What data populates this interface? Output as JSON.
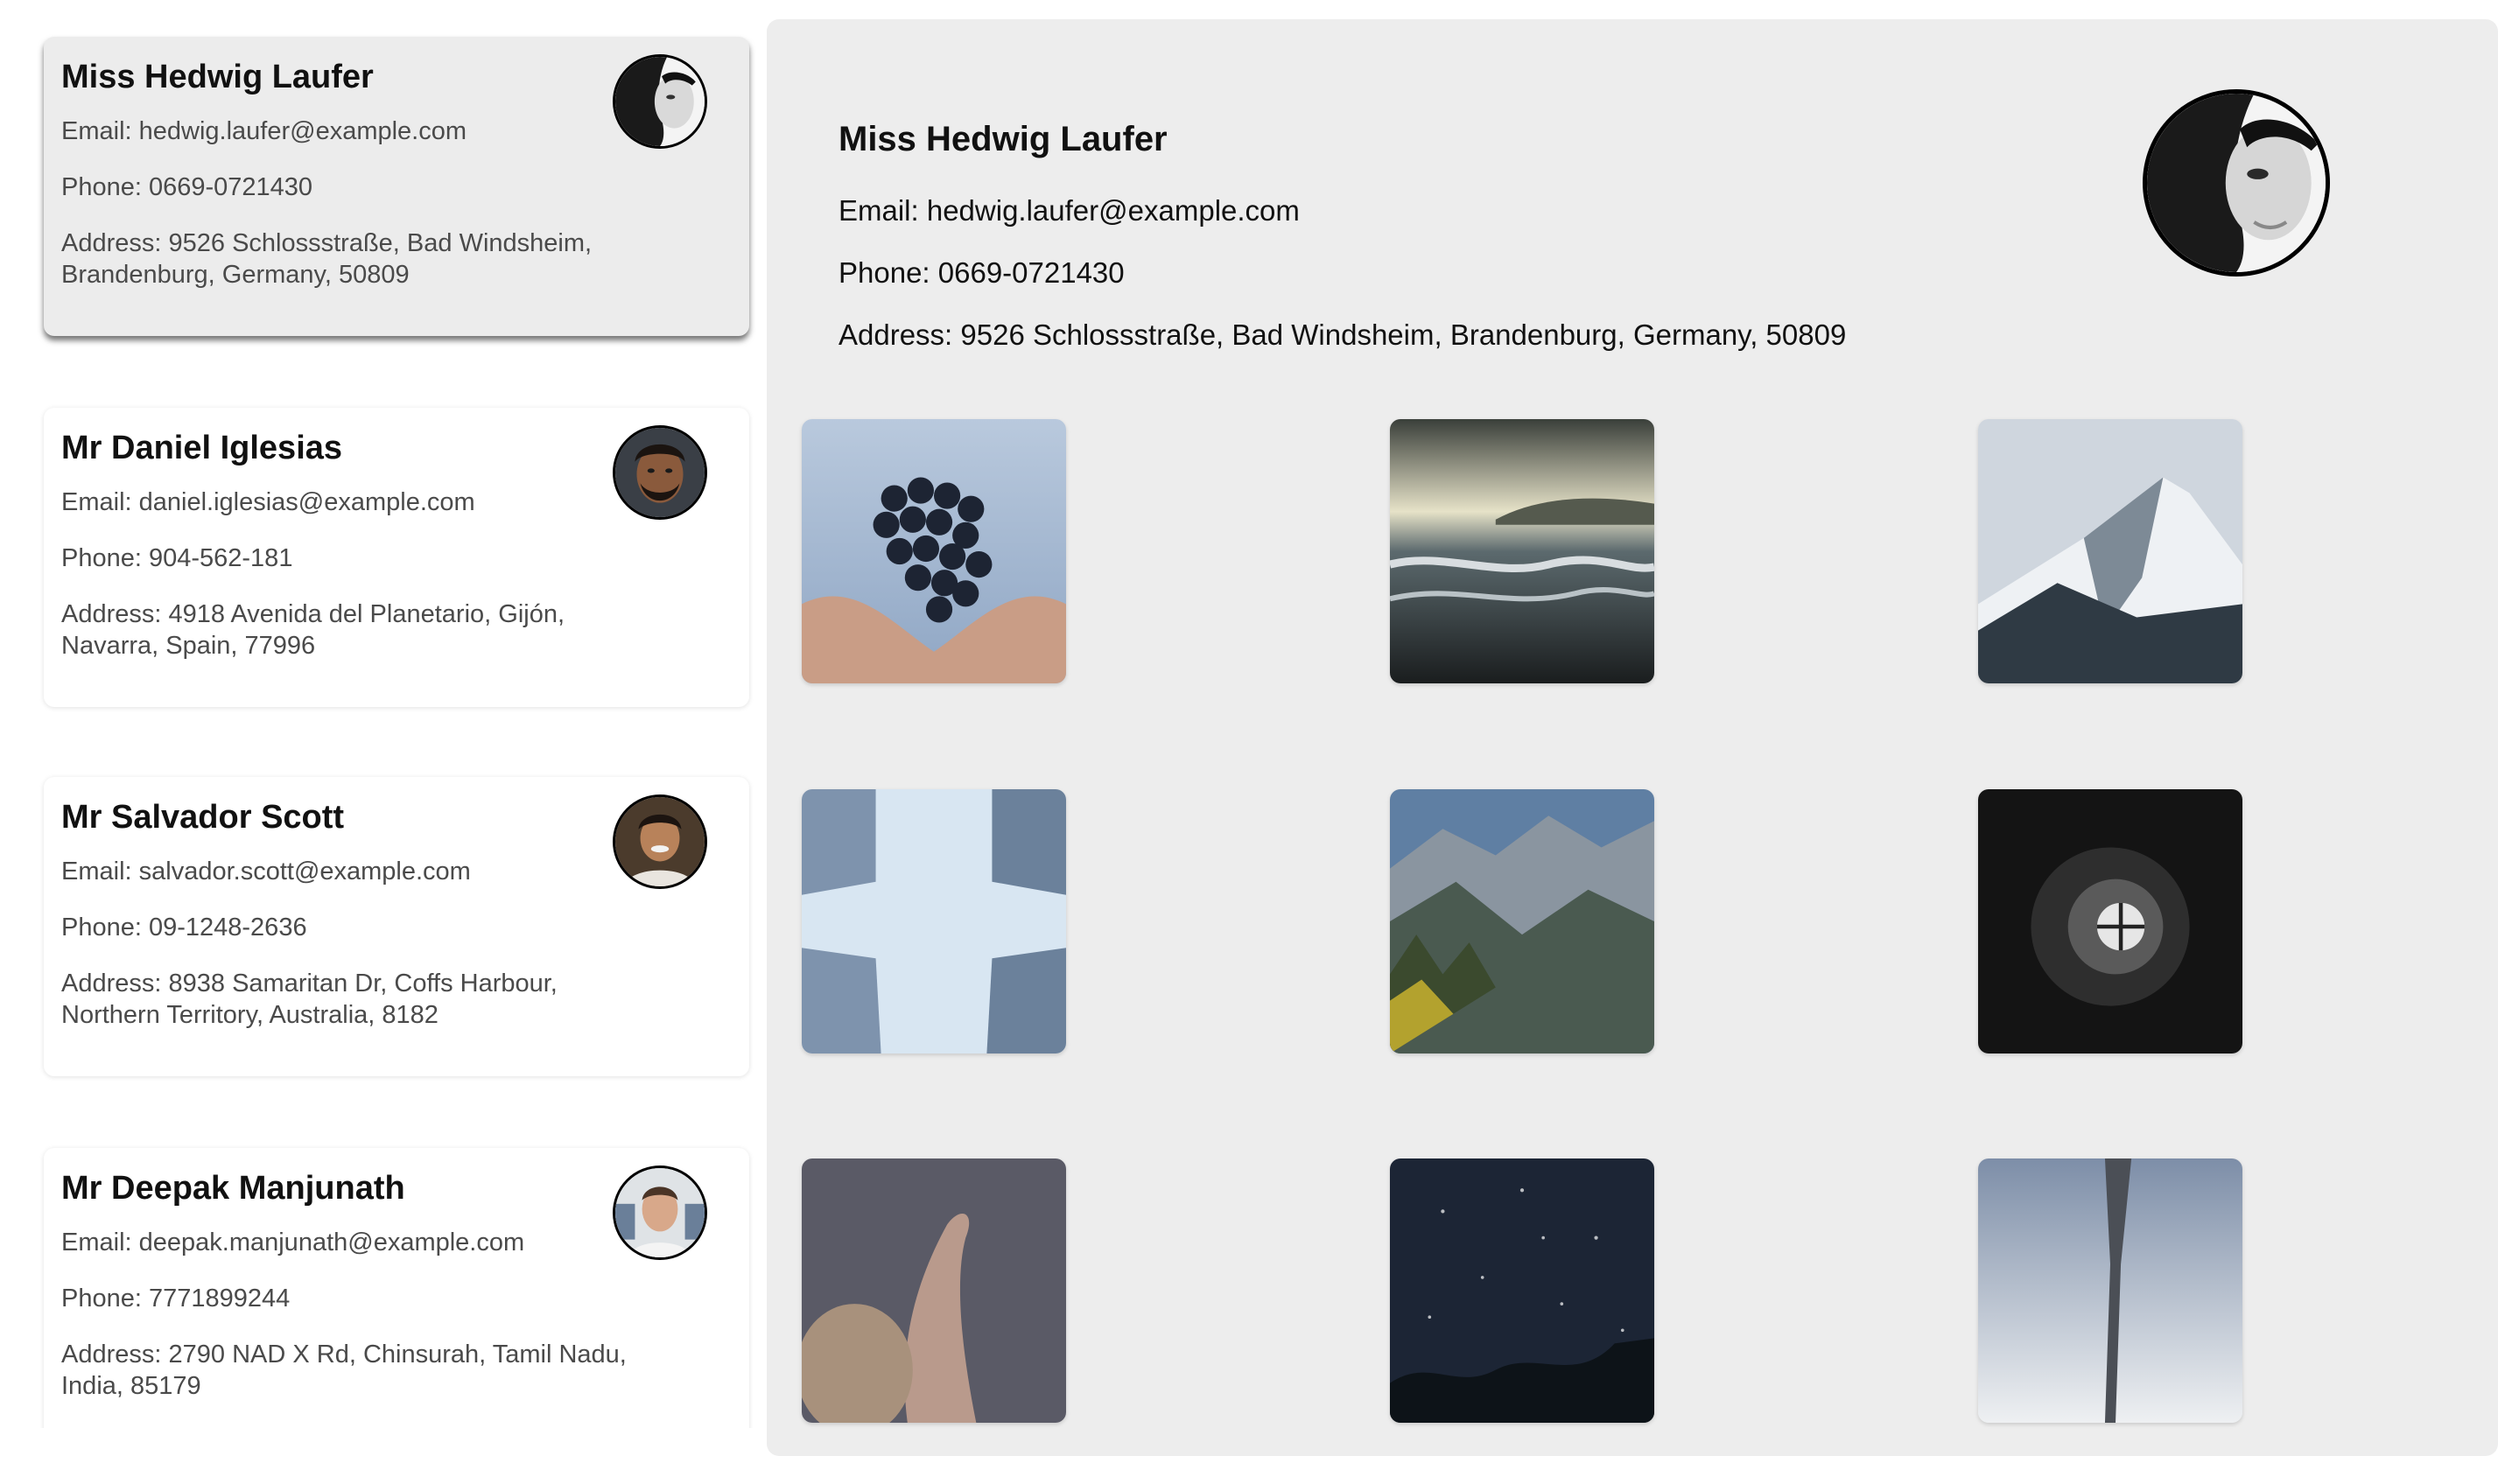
{
  "contacts": [
    {
      "name": "Miss Hedwig Laufer",
      "email": "Email: hedwig.laufer@example.com",
      "phone": "Phone: 0669-0721430",
      "address": "Address: 9526 Schlossstraße, Bad Windsheim, Brandenburg, Germany, 50809",
      "selected": true
    },
    {
      "name": "Mr Daniel Iglesias",
      "email": "Email: daniel.iglesias@example.com",
      "phone": "Phone: 904-562-181",
      "address": "Address: 4918 Avenida del Planetario, Gijón, Navarra, Spain, 77996"
    },
    {
      "name": "Mr Salvador Scott",
      "email": "Email: salvador.scott@example.com",
      "phone": "Phone: 09-1248-2636",
      "address": "Address: 8938 Samaritan Dr, Coffs Harbour, Northern Territory, Australia, 8182"
    },
    {
      "name": "Mr Deepak Manjunath",
      "email": "Email: deepak.manjunath@example.com",
      "phone": "Phone: 7771899244",
      "address": "Address: 2790 NAD X Rd, Chinsurah, Tamil Nadu, India, 85179"
    }
  ],
  "detail": {
    "name": "Miss Hedwig Laufer",
    "email": "Email: hedwig.laufer@example.com",
    "phone": "Phone: 0669-0721430",
    "address": "Address: 9526 Schlossstraße, Bad Windsheim, Brandenburg, Germany, 50809"
  },
  "photos": [
    {
      "subject": "grapes-in-hands"
    },
    {
      "subject": "ocean-shore"
    },
    {
      "subject": "snowy-mountain"
    },
    {
      "subject": "buildings-sky-cross"
    },
    {
      "subject": "mountain-valley"
    },
    {
      "subject": "spiral-staircase"
    },
    {
      "subject": "hand-on-rainy-window"
    },
    {
      "subject": "starry-night-sky"
    },
    {
      "subject": "tower-against-sky"
    }
  ],
  "colors": {
    "selected_card_bg": "#ececec",
    "detail_panel_bg": "#ededed",
    "secondary_text": "#4a4a4a"
  }
}
